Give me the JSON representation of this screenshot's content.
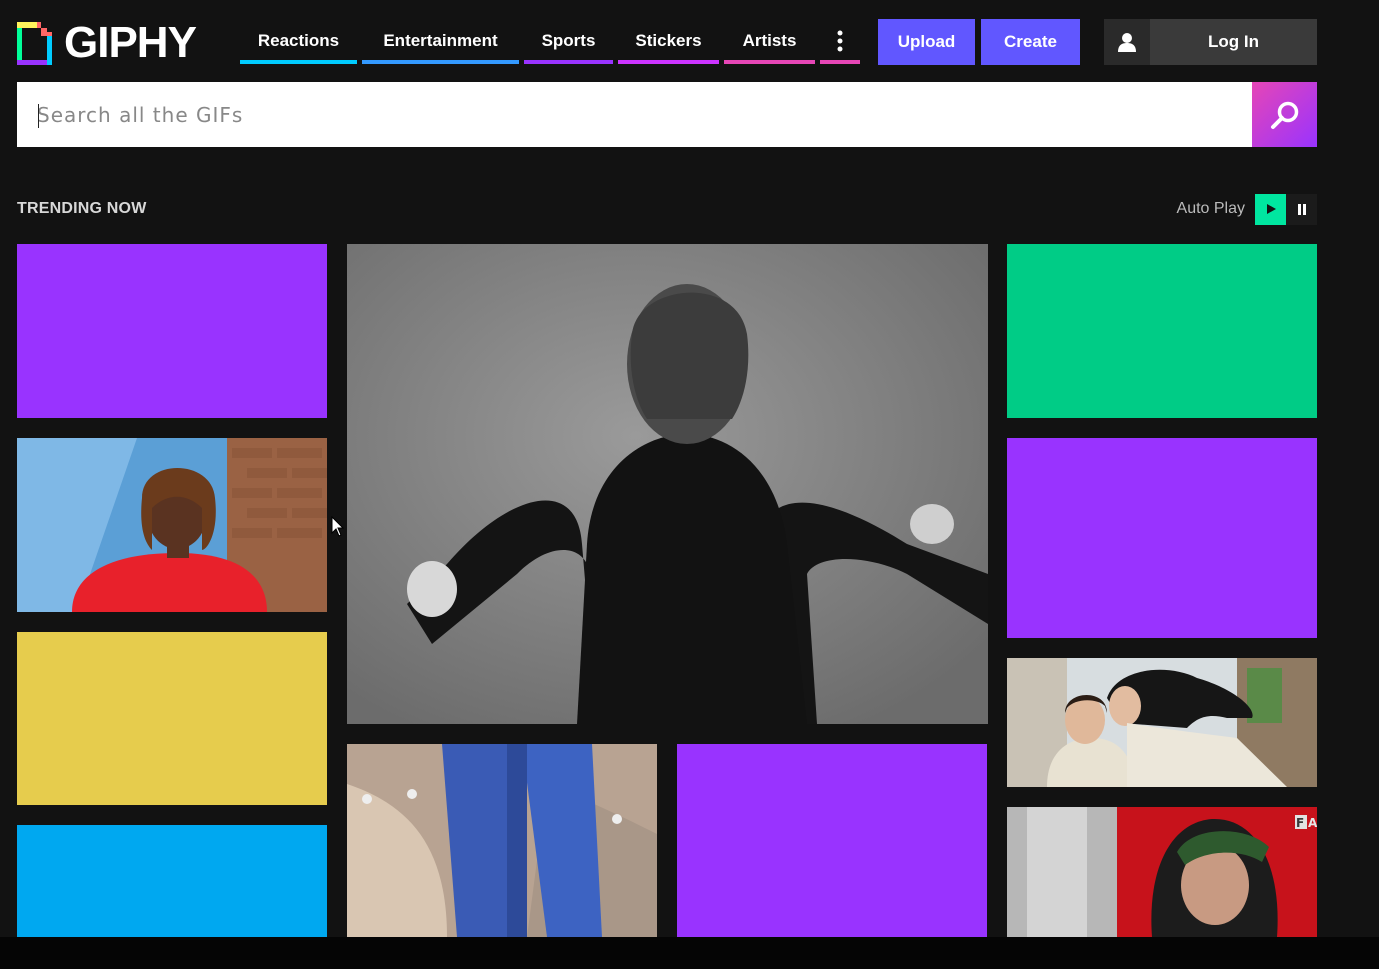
{
  "header": {
    "logo_text": "GIPHY",
    "nav": [
      {
        "label": "Reactions",
        "color": "#00ccff"
      },
      {
        "label": "Entertainment",
        "color": "#3399ff"
      },
      {
        "label": "Sports",
        "color": "#9933ff"
      },
      {
        "label": "Stickers",
        "color": "#cc33ff"
      },
      {
        "label": "Artists",
        "color": "#e646b6"
      }
    ],
    "more_icon": "more-vertical-icon",
    "upload_label": "Upload",
    "create_label": "Create",
    "login_label": "Log In",
    "login_icon": "user-icon"
  },
  "search": {
    "placeholder": "Search all the GIFs",
    "value": "",
    "icon": "search-icon"
  },
  "trending": {
    "title": "TRENDING NOW",
    "autoplay_label": "Auto Play",
    "play_icon": "play-icon",
    "pause_icon": "pause-icon"
  },
  "tiles": {
    "col1_badge_tile4": "",
    "gif_badge": "FAD"
  },
  "colors": {
    "accent": "#6157ff",
    "purple": "#9933ff",
    "green": "#00cc86",
    "yellow": "#e6cc4d",
    "blue": "#00a8f0",
    "autoplay_active": "#00e6a0"
  }
}
